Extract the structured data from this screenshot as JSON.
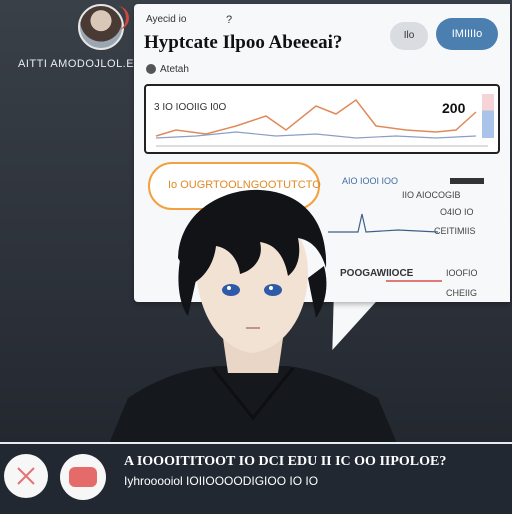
{
  "profile": {
    "name": "AITTI AMODOJLOL.EIT"
  },
  "panel": {
    "subtitle": "Ayecid io",
    "hint": "?",
    "title": "Hyptcate Ilpoo Abeeeai?",
    "btn_secondary": "Ilo",
    "btn_primary": "IMIIIIo",
    "section": "Atetah"
  },
  "chart_card": {
    "label": "3 IO IOOIIG I0O",
    "value": "200"
  },
  "pill": {
    "text": "Io OUGRTOOLNGOOTUTCTO"
  },
  "right": {
    "header": "AIO IOOI IOO",
    "line1": "IIO AIOCOGIB",
    "line2": "O4IO IO",
    "line3": "CEITIMIIS",
    "foot_label": "POOGAWIIOCE",
    "foot_side": "IOOFIO",
    "foot_side2": "CHEIIG"
  },
  "bottom": {
    "question": "A IOOOITITOOT IO DCI EDU II IC OO IIPOLOE?",
    "subline": "Iyhrooooiol IOIIOOOODIGIOO IO IO"
  },
  "colors": {
    "primary": "#4a7fb0",
    "accent": "#f2a040",
    "danger": "#e56a6a"
  },
  "icons": [
    "avatar",
    "close-icon",
    "reply-icon",
    "section-icon"
  ]
}
